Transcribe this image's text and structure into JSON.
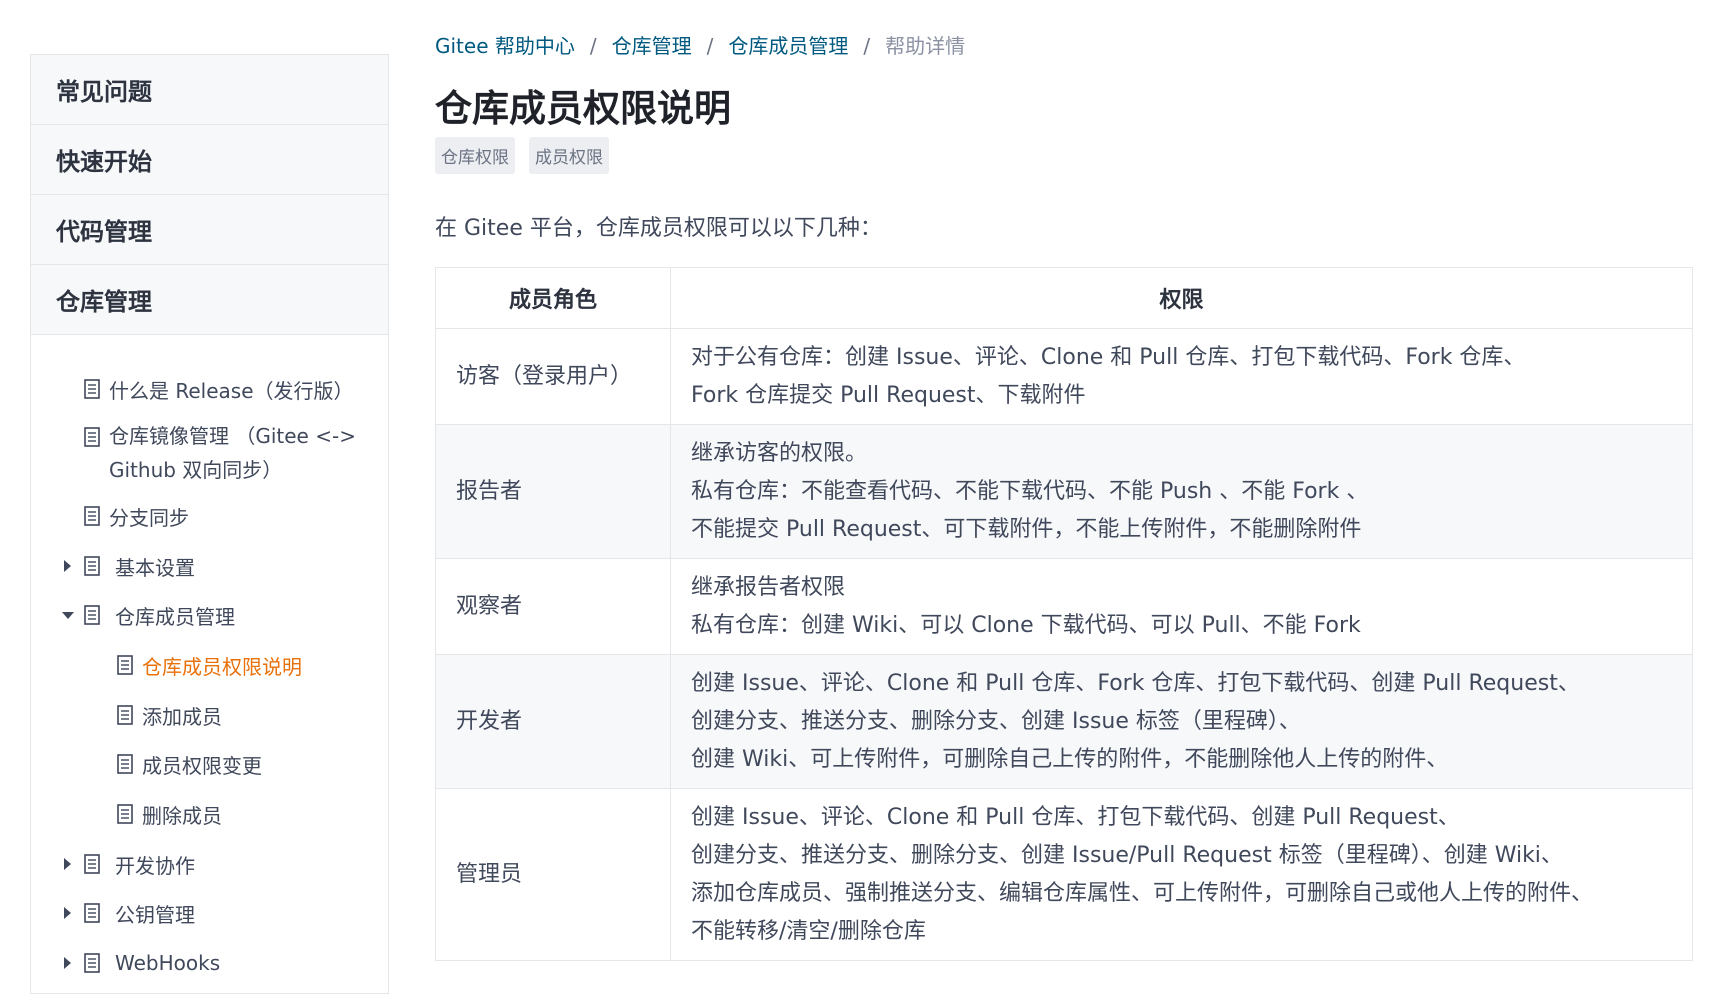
{
  "sidebar": {
    "categories": [
      {
        "label": "常见问题"
      },
      {
        "label": "快速开始"
      },
      {
        "label": "代码管理"
      },
      {
        "label": "仓库管理"
      }
    ],
    "tree": [
      {
        "label": "什么是 Release（发行版）"
      },
      {
        "label": "仓库镜像管理 （Gitee <->\nGithub 双向同步）"
      },
      {
        "label": "分支同步"
      },
      {
        "label": "基本设置",
        "expanded": false
      },
      {
        "label": "仓库成员管理",
        "expanded": true
      },
      {
        "label": "仓库成员权限说明",
        "active": true
      },
      {
        "label": "添加成员"
      },
      {
        "label": "成员权限变更"
      },
      {
        "label": "删除成员"
      },
      {
        "label": "开发协作",
        "expanded": false
      },
      {
        "label": "公钥管理",
        "expanded": false
      },
      {
        "label": "WebHooks",
        "expanded": false
      }
    ],
    "icons": {
      "collapsed": "caret-right-icon",
      "expanded": "caret-down-icon",
      "doc": "document-icon"
    },
    "colors": {
      "active": "#e8710a"
    }
  },
  "breadcrumb": {
    "items": [
      "Gitee 帮助中心",
      "仓库管理",
      "仓库成员管理",
      "帮助详情"
    ],
    "separator": "/"
  },
  "article": {
    "title": "仓库成员权限说明",
    "tags": [
      "仓库权限",
      "成员权限"
    ],
    "intro": "在 Gitee 平台，仓库成员权限可以以下几种："
  },
  "table": {
    "headers": [
      "成员角色",
      "权限"
    ],
    "rows": [
      {
        "role": "访客（登录用户）",
        "permissions": [
          "对于公有仓库：创建 Issue、评论、Clone 和 Pull 仓库、打包下载代码、Fork 仓库、",
          "Fork 仓库提交 Pull Request、下载附件"
        ]
      },
      {
        "role": "报告者",
        "permissions": [
          "继承访客的权限。",
          "私有仓库：不能查看代码、不能下载代码、不能 Push 、不能 Fork 、",
          "不能提交 Pull Request、可下载附件，不能上传附件，不能删除附件"
        ]
      },
      {
        "role": "观察者",
        "permissions": [
          "继承报告者权限",
          "私有仓库：创建 Wiki、可以 Clone 下载代码、可以 Pull、不能 Fork"
        ]
      },
      {
        "role": "开发者",
        "permissions": [
          "创建 Issue、评论、Clone 和 Pull 仓库、Fork 仓库、打包下载代码、创建 Pull Request、",
          "创建分支、推送分支、删除分支、创建 Issue 标签（里程碑）、",
          "创建 Wiki、可上传附件，可删除自己上传的附件，不能删除他人上传的附件、"
        ]
      },
      {
        "role": "管理员",
        "permissions": [
          "创建 Issue、评论、Clone 和 Pull 仓库、打包下载代码、创建 Pull Request、",
          "创建分支、推送分支、删除分支、创建 Issue/Pull Request 标签（里程碑）、创建 Wiki、",
          "添加仓库成员、强制推送分支、编辑仓库属性、可上传附件，可删除自己或他人上传的附件、",
          "不能转移/清空/删除仓库"
        ]
      }
    ]
  }
}
